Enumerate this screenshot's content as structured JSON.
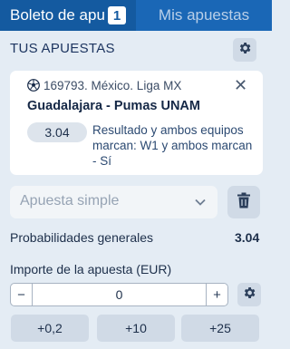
{
  "tabs": {
    "active_label": "Boleto de apuestas",
    "active_badge": "1",
    "inactive_label": "Mis apuestas"
  },
  "section": {
    "title": "TUS APUESTAS"
  },
  "bet": {
    "league": "169793. México. Liga MX",
    "match": "Guadalajara - Pumas UNAM",
    "odd": "3.04",
    "outcome": "Resultado y ambos equipos marcan: W1 y ambos marcan - Sí"
  },
  "bet_type": {
    "selected": "Apuesta simple"
  },
  "summary": {
    "prob_label": "Probabilidades generales",
    "prob_value": "3.04"
  },
  "amount": {
    "label": "Importe de la apuesta (EUR)",
    "value": "0",
    "minus": "−",
    "plus": "+"
  },
  "quick_amounts": [
    "+0,2",
    "+10",
    "+25"
  ],
  "icons": {
    "settings": "gear-icon",
    "delete": "trash-icon",
    "sport": "soccer-ball-icon",
    "remove": "close-icon",
    "dropdown": "chevron-down-icon"
  },
  "colors": {
    "tab_bar": "#1a67b6",
    "tab_active": "#145aa0",
    "background": "#e4ecf4",
    "card": "#ffffff",
    "button": "#d0dae6"
  }
}
